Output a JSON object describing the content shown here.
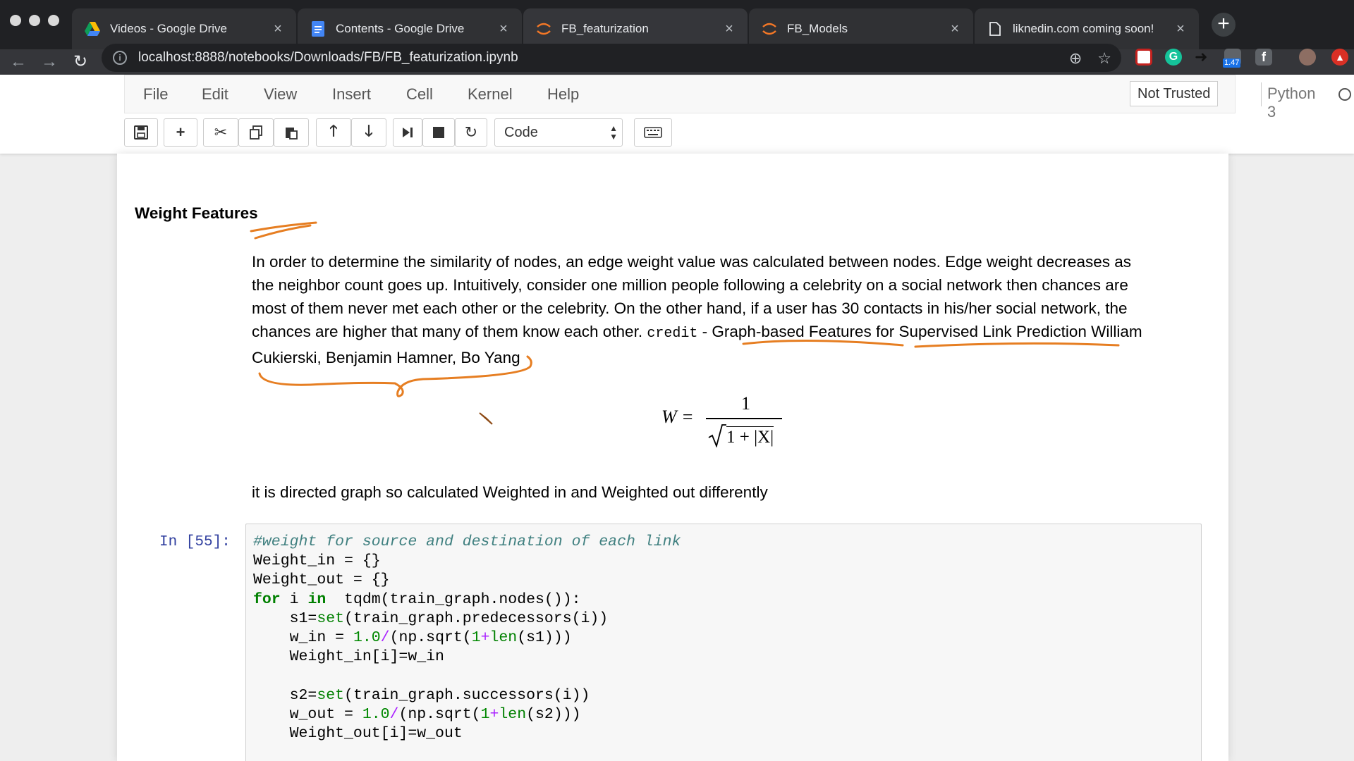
{
  "browser": {
    "tabs": [
      {
        "title": "Videos - Google Drive",
        "icon": "google-drive-icon"
      },
      {
        "title": "Contents - Google Drive",
        "icon": "google-docs-icon"
      },
      {
        "title": "FB_featurization",
        "icon": "jupyter-icon",
        "active": true
      },
      {
        "title": "FB_Models",
        "icon": "jupyter-icon"
      },
      {
        "title": "liknedin.com coming soon!",
        "icon": "page-icon"
      }
    ],
    "url": "localhost:8888/notebooks/Downloads/FB/FB_featurization.ipynb",
    "extension_badge": "1.47"
  },
  "jupyter": {
    "menu": [
      "File",
      "Edit",
      "View",
      "Insert",
      "Cell",
      "Kernel",
      "Help"
    ],
    "trust_status": "Not Trusted",
    "kernel": "Python 3",
    "cell_type": "Code"
  },
  "markdown": {
    "heading": "Weight Features",
    "paragraph_lines": [
      "In order to determine the similarity of nodes, an edge weight value was calculated between nodes. Edge weight decreases as",
      "the neighbor count goes up. Intuitively, consider one million people following a celebrity on a social network then chances are",
      "most of them never met each other or the celebrity. On the other hand, if a user has 30 contacts in his/her social network, the",
      "chances are higher that many of them know each other."
    ],
    "credit_code": "credit",
    "credit_text": " - Graph-based Features for Supervised Link Prediction William",
    "credit_line2": "Cukierski, Benjamin Hamner, Bo Yang",
    "formula": {
      "lhs": "W =",
      "numerator": "1",
      "denominator": "1 + |X|"
    },
    "note": "it is directed graph so calculated Weighted in and Weighted out differently"
  },
  "code_cell": {
    "prompt": "In [55]:",
    "lines": [
      "#weight for source and destination of each link",
      "Weight_in = {}",
      "Weight_out = {}",
      "for i in  tqdm(train_graph.nodes()):",
      "    s1=set(train_graph.predecessors(i))",
      "    w_in = 1.0/(np.sqrt(1+len(s1)))",
      "    Weight_in[i]=w_in",
      "",
      "    s2=set(train_graph.successors(i))",
      "    w_out = 1.0/(np.sqrt(1+len(s2)))",
      "    Weight_out[i]=w_out"
    ]
  },
  "colors": {
    "annotation": "#e67e22",
    "prompt": "#303f9f",
    "keyword": "#008000",
    "comment": "#408080"
  }
}
